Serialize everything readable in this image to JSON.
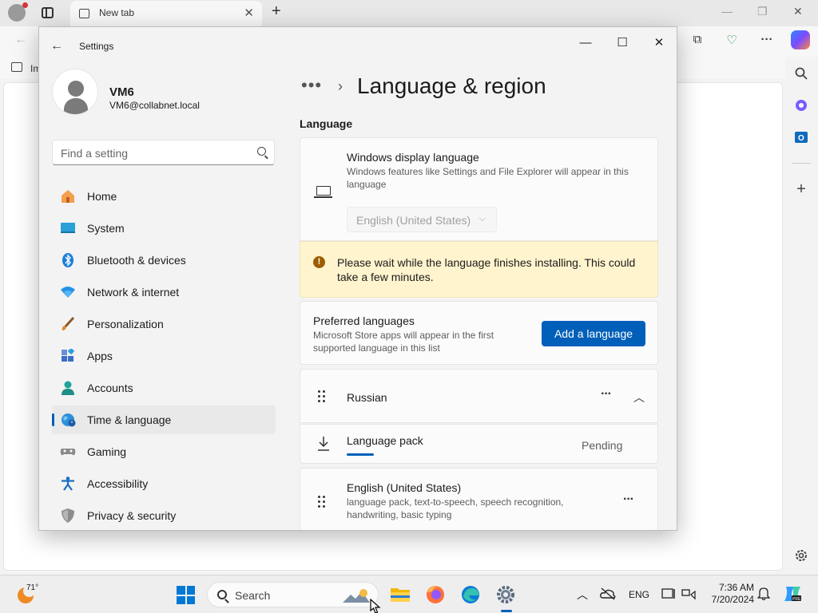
{
  "browser": {
    "tab_title": "New tab",
    "favorites_label": "Im"
  },
  "settings": {
    "app_title": "Settings",
    "user": {
      "name": "VM6",
      "email": "VM6@collabnet.local"
    },
    "search": {
      "placeholder": "Find a setting"
    },
    "nav": [
      {
        "label": "Home",
        "icon": "home-icon",
        "active": false
      },
      {
        "label": "System",
        "icon": "system-icon",
        "active": false
      },
      {
        "label": "Bluetooth & devices",
        "icon": "bluetooth-icon",
        "active": false
      },
      {
        "label": "Network & internet",
        "icon": "wifi-icon",
        "active": false
      },
      {
        "label": "Personalization",
        "icon": "brush-icon",
        "active": false
      },
      {
        "label": "Apps",
        "icon": "apps-icon",
        "active": false
      },
      {
        "label": "Accounts",
        "icon": "accounts-icon",
        "active": false
      },
      {
        "label": "Time & language",
        "icon": "time-language-icon",
        "active": true
      },
      {
        "label": "Gaming",
        "icon": "gamepad-icon",
        "active": false
      },
      {
        "label": "Accessibility",
        "icon": "accessibility-icon",
        "active": false
      },
      {
        "label": "Privacy & security",
        "icon": "shield-icon",
        "active": false
      }
    ],
    "page_title": "Language & region",
    "section_label": "Language",
    "display_language": {
      "title": "Windows display language",
      "description": "Windows features like Settings and File Explorer will appear in this language",
      "selected": "English (United States)"
    },
    "warning": {
      "text": "Please wait while the language finishes installing. This could take a few minutes."
    },
    "preferred": {
      "title": "Preferred languages",
      "description": "Microsoft Store apps will appear in the first supported language in this list",
      "add_button": "Add a language"
    },
    "languages": [
      {
        "name": "Russian"
      },
      {
        "name": "English (United States)",
        "features": "language pack, text-to-speech, speech recognition, handwriting, basic typing"
      }
    ],
    "language_pack": {
      "label": "Language pack",
      "status": "Pending",
      "progress": 0.28
    }
  },
  "taskbar": {
    "weather_temp": "71°",
    "search_label": "Search",
    "input_lang": "ENG",
    "time": "7:36 AM",
    "date": "7/20/2024"
  },
  "colors": {
    "accent": "#005fb8",
    "warning_bg": "#fff4ce"
  }
}
